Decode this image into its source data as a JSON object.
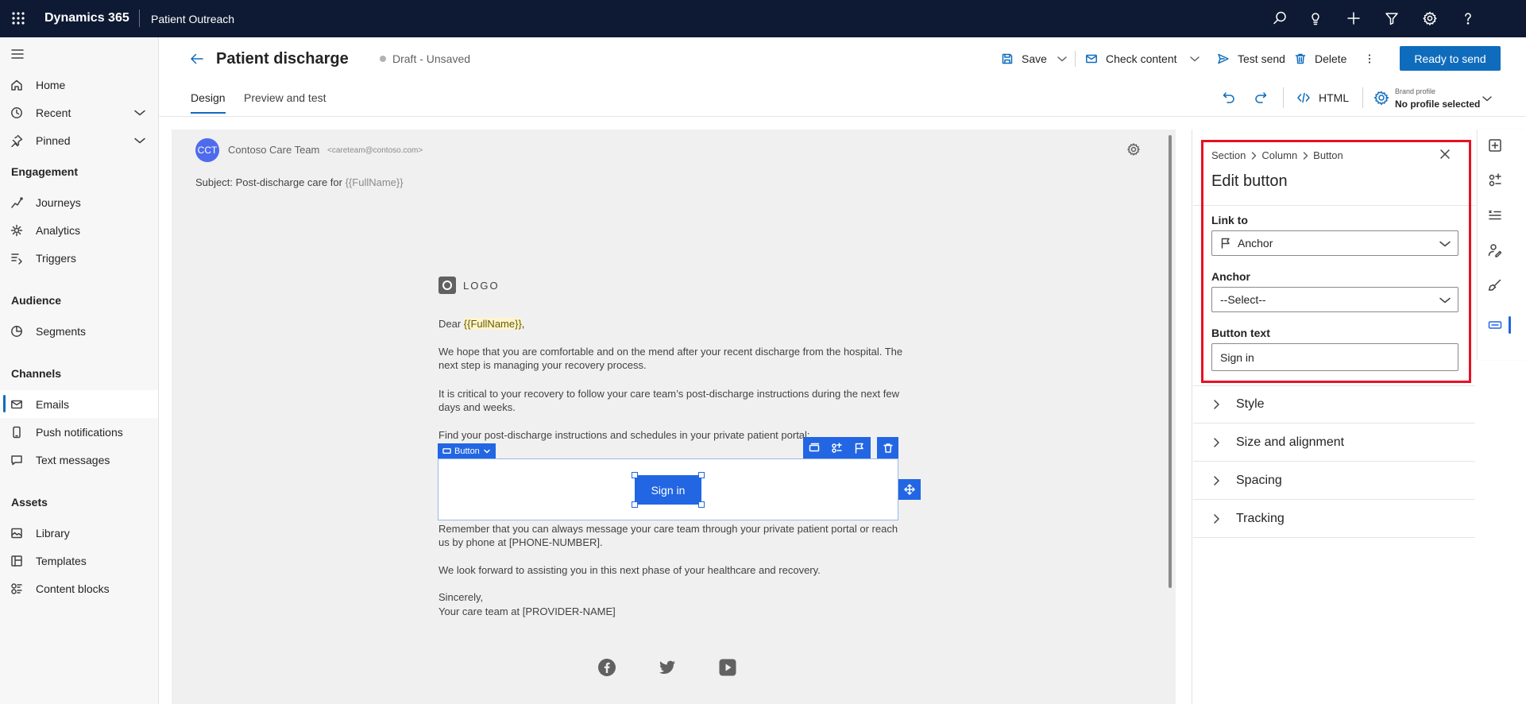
{
  "topbar": {
    "app_name": "Dynamics 365",
    "area_name": "Patient Outreach",
    "icons": [
      "waffle-icon",
      "search-icon",
      "lightbulb-icon",
      "plus-icon",
      "filter-icon",
      "settings-icon",
      "help-icon"
    ]
  },
  "nav": {
    "home": "Home",
    "recent": "Recent",
    "pinned": "Pinned",
    "group_engagement": "Engagement",
    "journeys": "Journeys",
    "analytics": "Analytics",
    "triggers": "Triggers",
    "group_audience": "Audience",
    "segments": "Segments",
    "group_channels": "Channels",
    "emails": "Emails",
    "push": "Push notifications",
    "text": "Text messages",
    "group_assets": "Assets",
    "library": "Library",
    "templates": "Templates",
    "content_blocks": "Content blocks",
    "active_item": "Emails"
  },
  "header": {
    "title": "Patient discharge",
    "status": "Draft - Unsaved",
    "save": "Save",
    "check_content": "Check content",
    "test_send": "Test send",
    "delete": "Delete",
    "ready": "Ready to send"
  },
  "tabs": {
    "design": "Design",
    "preview": "Preview and test",
    "html": "HTML",
    "brand_label": "Brand profile",
    "brand_value": "No profile selected"
  },
  "email": {
    "sender_initials": "CCT",
    "sender_name": "Contoso Care Team",
    "sender_email": "<careteam@contoso.com>",
    "subject_prefix": "Subject: Post-discharge care for ",
    "subject_token": "{{FullName}}",
    "logo_text": "LOGO",
    "dear": "Dear ",
    "dear_token": "{{FullName}}",
    "dear_suffix": ",",
    "para1": "We hope that you are comfortable and on the mend after your recent discharge from the hospital. The next step is managing your recovery process.",
    "para2": "It is critical to your recovery to follow your care team’s post-discharge instructions during the next few days and weeks.",
    "para3": "Find your post-discharge instructions and schedules in your private patient portal:",
    "button_tag": "Button",
    "button_label": "Sign in",
    "para4": "Remember that you can always message your care team through your private patient portal or reach us by phone at [PHONE-NUMBER].",
    "para5": "We look forward to assisting you in this next phase of your healthcare and recovery.",
    "closing": "Sincerely,",
    "signature": "Your care team at [PROVIDER-NAME]"
  },
  "panel": {
    "crumb_section": "Section",
    "crumb_column": "Column",
    "crumb_button": "Button",
    "title": "Edit button",
    "link_to_label": "Link to",
    "link_to_value": "Anchor",
    "anchor_label": "Anchor",
    "anchor_value": "--Select--",
    "button_text_label": "Button text",
    "button_text_value": "Sign in",
    "sections": [
      "Style",
      "Size and alignment",
      "Spacing",
      "Tracking"
    ]
  },
  "colors": {
    "topbar": "#0e1a33",
    "accent": "#0f6cbd",
    "editor_blue": "#2266e3",
    "highlight": "#e81123"
  }
}
